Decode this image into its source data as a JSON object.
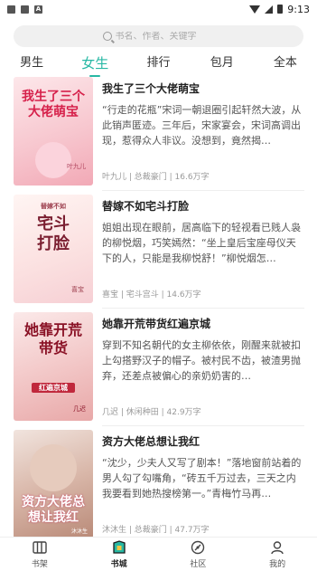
{
  "status_bar": {
    "time": "9:13",
    "icons": [
      "notification-icon",
      "notification-icon",
      "a-icon"
    ]
  },
  "search": {
    "placeholder": "书名、作者、关键字"
  },
  "tabs": [
    {
      "label": "男生",
      "active": false
    },
    {
      "label": "女生",
      "active": true
    },
    {
      "label": "排行",
      "active": false
    },
    {
      "label": "包月",
      "active": false
    },
    {
      "label": "全本",
      "active": false
    }
  ],
  "books": [
    {
      "title": "我生了三个大佬萌宝",
      "desc": "“行走的花瓶”宋词一朝退圈引起轩然大波，从此销声匿迹。三年后，宋家宴会，宋词高调出现，惹得众人非议。没想到，竟然揭…",
      "meta": "叶九儿 | 总裁豪门 | 16.6万字",
      "cover_text": "我生了三个大佬萌宝",
      "cover_author": "叶九儿"
    },
    {
      "title": "替嫁不如宅斗打脸",
      "desc": "姐姐出现在眼前，居高临下的轻视看已贱人袅的柳悦烟，巧笑嫣然：“坐上皇后宝座母仪天下的人，只能是我柳悦舒！”柳悦烟怎…",
      "meta": "喜宝 | 宅斗宫斗 | 14.6万字",
      "cover_text": "宅斗打脸",
      "cover_sub": "替嫁不如",
      "cover_author": "喜宝"
    },
    {
      "title": "她靠开荒带货红遍京城",
      "desc": "穿到不知名朝代的女主柳依依，刚醒来就被扣上勾搭野汉子的帽子。被村民不齿，被渣男抛弃，还差点被偏心的亲奶奶害的…",
      "meta": "几迟 | 休闲种田 | 42.9万字",
      "cover_text": "她靠开荒带货",
      "cover_sub": "红遍京城",
      "cover_author": "几迟"
    },
    {
      "title": "资方大佬总想让我红",
      "desc": "“沈少，少夫人又写了剧本！”落地窗前站着的男人勾了勾嘴角，“砖五千万过去，三天之内我要看到她热搜榜第一。”青梅竹马再…",
      "meta": "沐沐生 | 总裁豪门 | 47.7万字",
      "cover_text": "资方大佬总想让我红",
      "cover_author": "沐沐生"
    }
  ],
  "bottom_nav": [
    {
      "label": "书架",
      "icon": "bookshelf-icon",
      "active": false
    },
    {
      "label": "书城",
      "icon": "bookstore-icon",
      "active": true
    },
    {
      "label": "社区",
      "icon": "community-icon",
      "active": false
    },
    {
      "label": "我的",
      "icon": "profile-icon",
      "active": false
    }
  ],
  "colors": {
    "accent": "#27b8a4"
  }
}
